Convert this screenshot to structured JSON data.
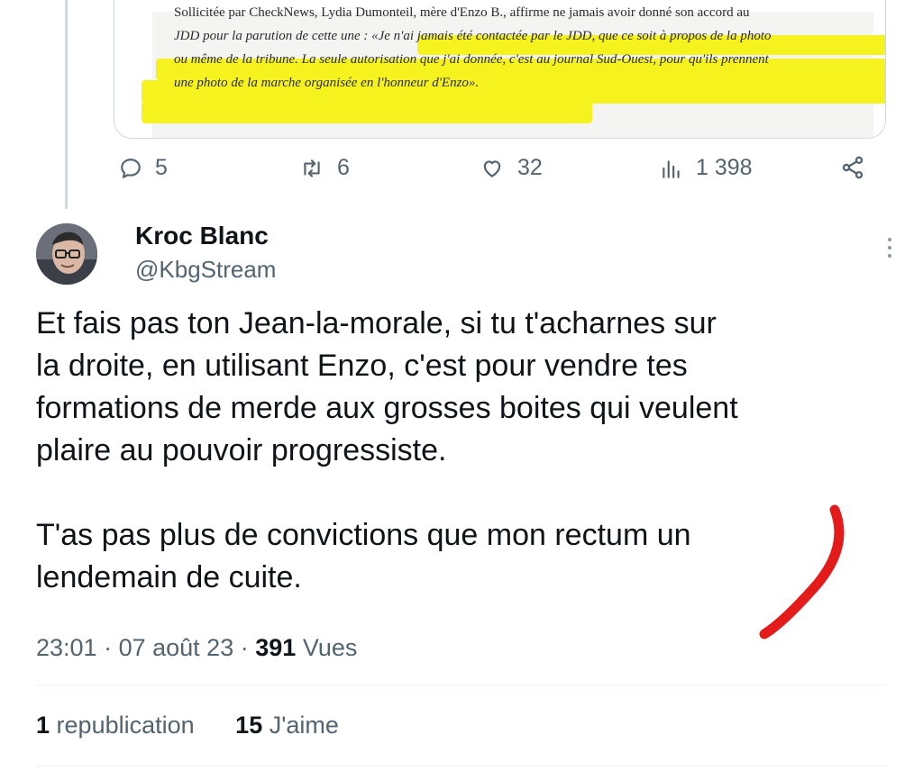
{
  "quoted_article": {
    "lines": [
      "Sollicitée par CheckNews, Lydia Dumonteil, mère d'Enzo B., affirme ne jamais avoir donné son accord au",
      "JDD pour la parution de cette une : «Je n'ai jamais été contactée par le JDD, que ce soit à propos de la photo",
      "ou même de la tribune. La seule autorisation que j'ai donnée, c'est au journal Sud-Ouest, pour qu'ils prennent",
      "une photo de la marche organisée en l'honneur d'Enzo»."
    ]
  },
  "parent_actions": {
    "replies": "5",
    "reposts": "6",
    "likes": "32",
    "views": "1 398",
    "icons": [
      "reply-icon",
      "repost-icon",
      "like-icon",
      "views-icon",
      "share-icon"
    ]
  },
  "tweet": {
    "author_name": "Kroc Blanc",
    "author_handle": "@KbgStream",
    "paragraph1": [
      "Et fais pas ton Jean-la-morale, si tu t'acharnes sur",
      "la droite, en utilisant Enzo, c'est pour vendre tes",
      "formations de merde aux grosses boites qui veulent",
      "plaire au pouvoir progressiste."
    ],
    "paragraph2": [
      "T'as pas plus de convictions que mon rectum un",
      "lendemain de cuite."
    ],
    "time": "23:01",
    "date": "07 août 23",
    "views_count": "391",
    "views_label": "Vues",
    "reposts_count": "1",
    "reposts_label": "republication",
    "likes_count": "15",
    "likes_label": "J'aime"
  },
  "colors": {
    "highlight": "#f6f21e",
    "annotation": "#e41b1b",
    "secondary_text": "#536471",
    "primary_text": "#0f1419"
  }
}
